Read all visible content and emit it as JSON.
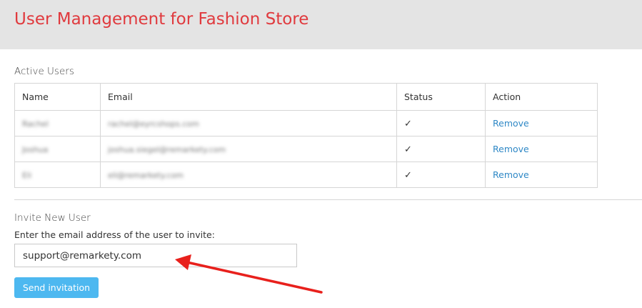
{
  "header": {
    "title": "User Management for Fashion Store"
  },
  "active_users": {
    "section_title": "Active Users",
    "columns": [
      "Name",
      "Email",
      "Status",
      "Action"
    ],
    "rows": [
      {
        "name": "Rachel",
        "email": "rachel@eyrcshops.com",
        "status_icon": "checkmark-icon",
        "action": "Remove"
      },
      {
        "name": "Joshua",
        "email": "joshua.siegel@remarkety.com",
        "status_icon": "checkmark-icon",
        "action": "Remove"
      },
      {
        "name": "Eli",
        "email": "eli@remarkety.com",
        "status_icon": "checkmark-icon",
        "action": "Remove"
      }
    ]
  },
  "invite": {
    "section_title": "Invite New User",
    "label": "Enter the email address of the user to invite:",
    "email_value": "support@remarkety.com",
    "button_label": "Send invitation"
  },
  "colors": {
    "title": "#e03a3e",
    "header_bg": "#e4e4e4",
    "link": "#2f88c6",
    "button": "#4db8f0",
    "arrow": "#e8201c"
  }
}
